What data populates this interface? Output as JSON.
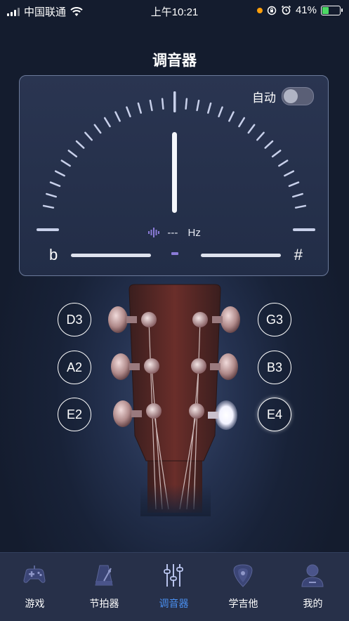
{
  "status_bar": {
    "carrier": "中国联通",
    "time": "上午10:21",
    "battery": "41%",
    "battery_level": 0.41
  },
  "page": {
    "title": "调音器"
  },
  "tuner": {
    "auto_label": "自动",
    "auto_enabled": false,
    "hz_value": "---",
    "hz_unit": "Hz",
    "flat_symbol": "b",
    "sharp_symbol": "#"
  },
  "strings": {
    "left": [
      "D3",
      "A2",
      "E2"
    ],
    "right": [
      "G3",
      "B3",
      "E4"
    ],
    "selected": "E4"
  },
  "tabbar": {
    "items": [
      {
        "label": "游戏",
        "icon": "gamepad-icon"
      },
      {
        "label": "节拍器",
        "icon": "metronome-icon"
      },
      {
        "label": "调音器",
        "icon": "tuner-sliders-icon"
      },
      {
        "label": "学吉他",
        "icon": "guitar-pick-icon"
      },
      {
        "label": "我的",
        "icon": "profile-icon"
      }
    ],
    "active_index": 2,
    "active_color": "#4a8ff0"
  },
  "colors": {
    "background": "#182238",
    "panel_border": "#6b7a9a",
    "tick": "#c8d0ea",
    "accent_purple": "#8b7bd8"
  }
}
